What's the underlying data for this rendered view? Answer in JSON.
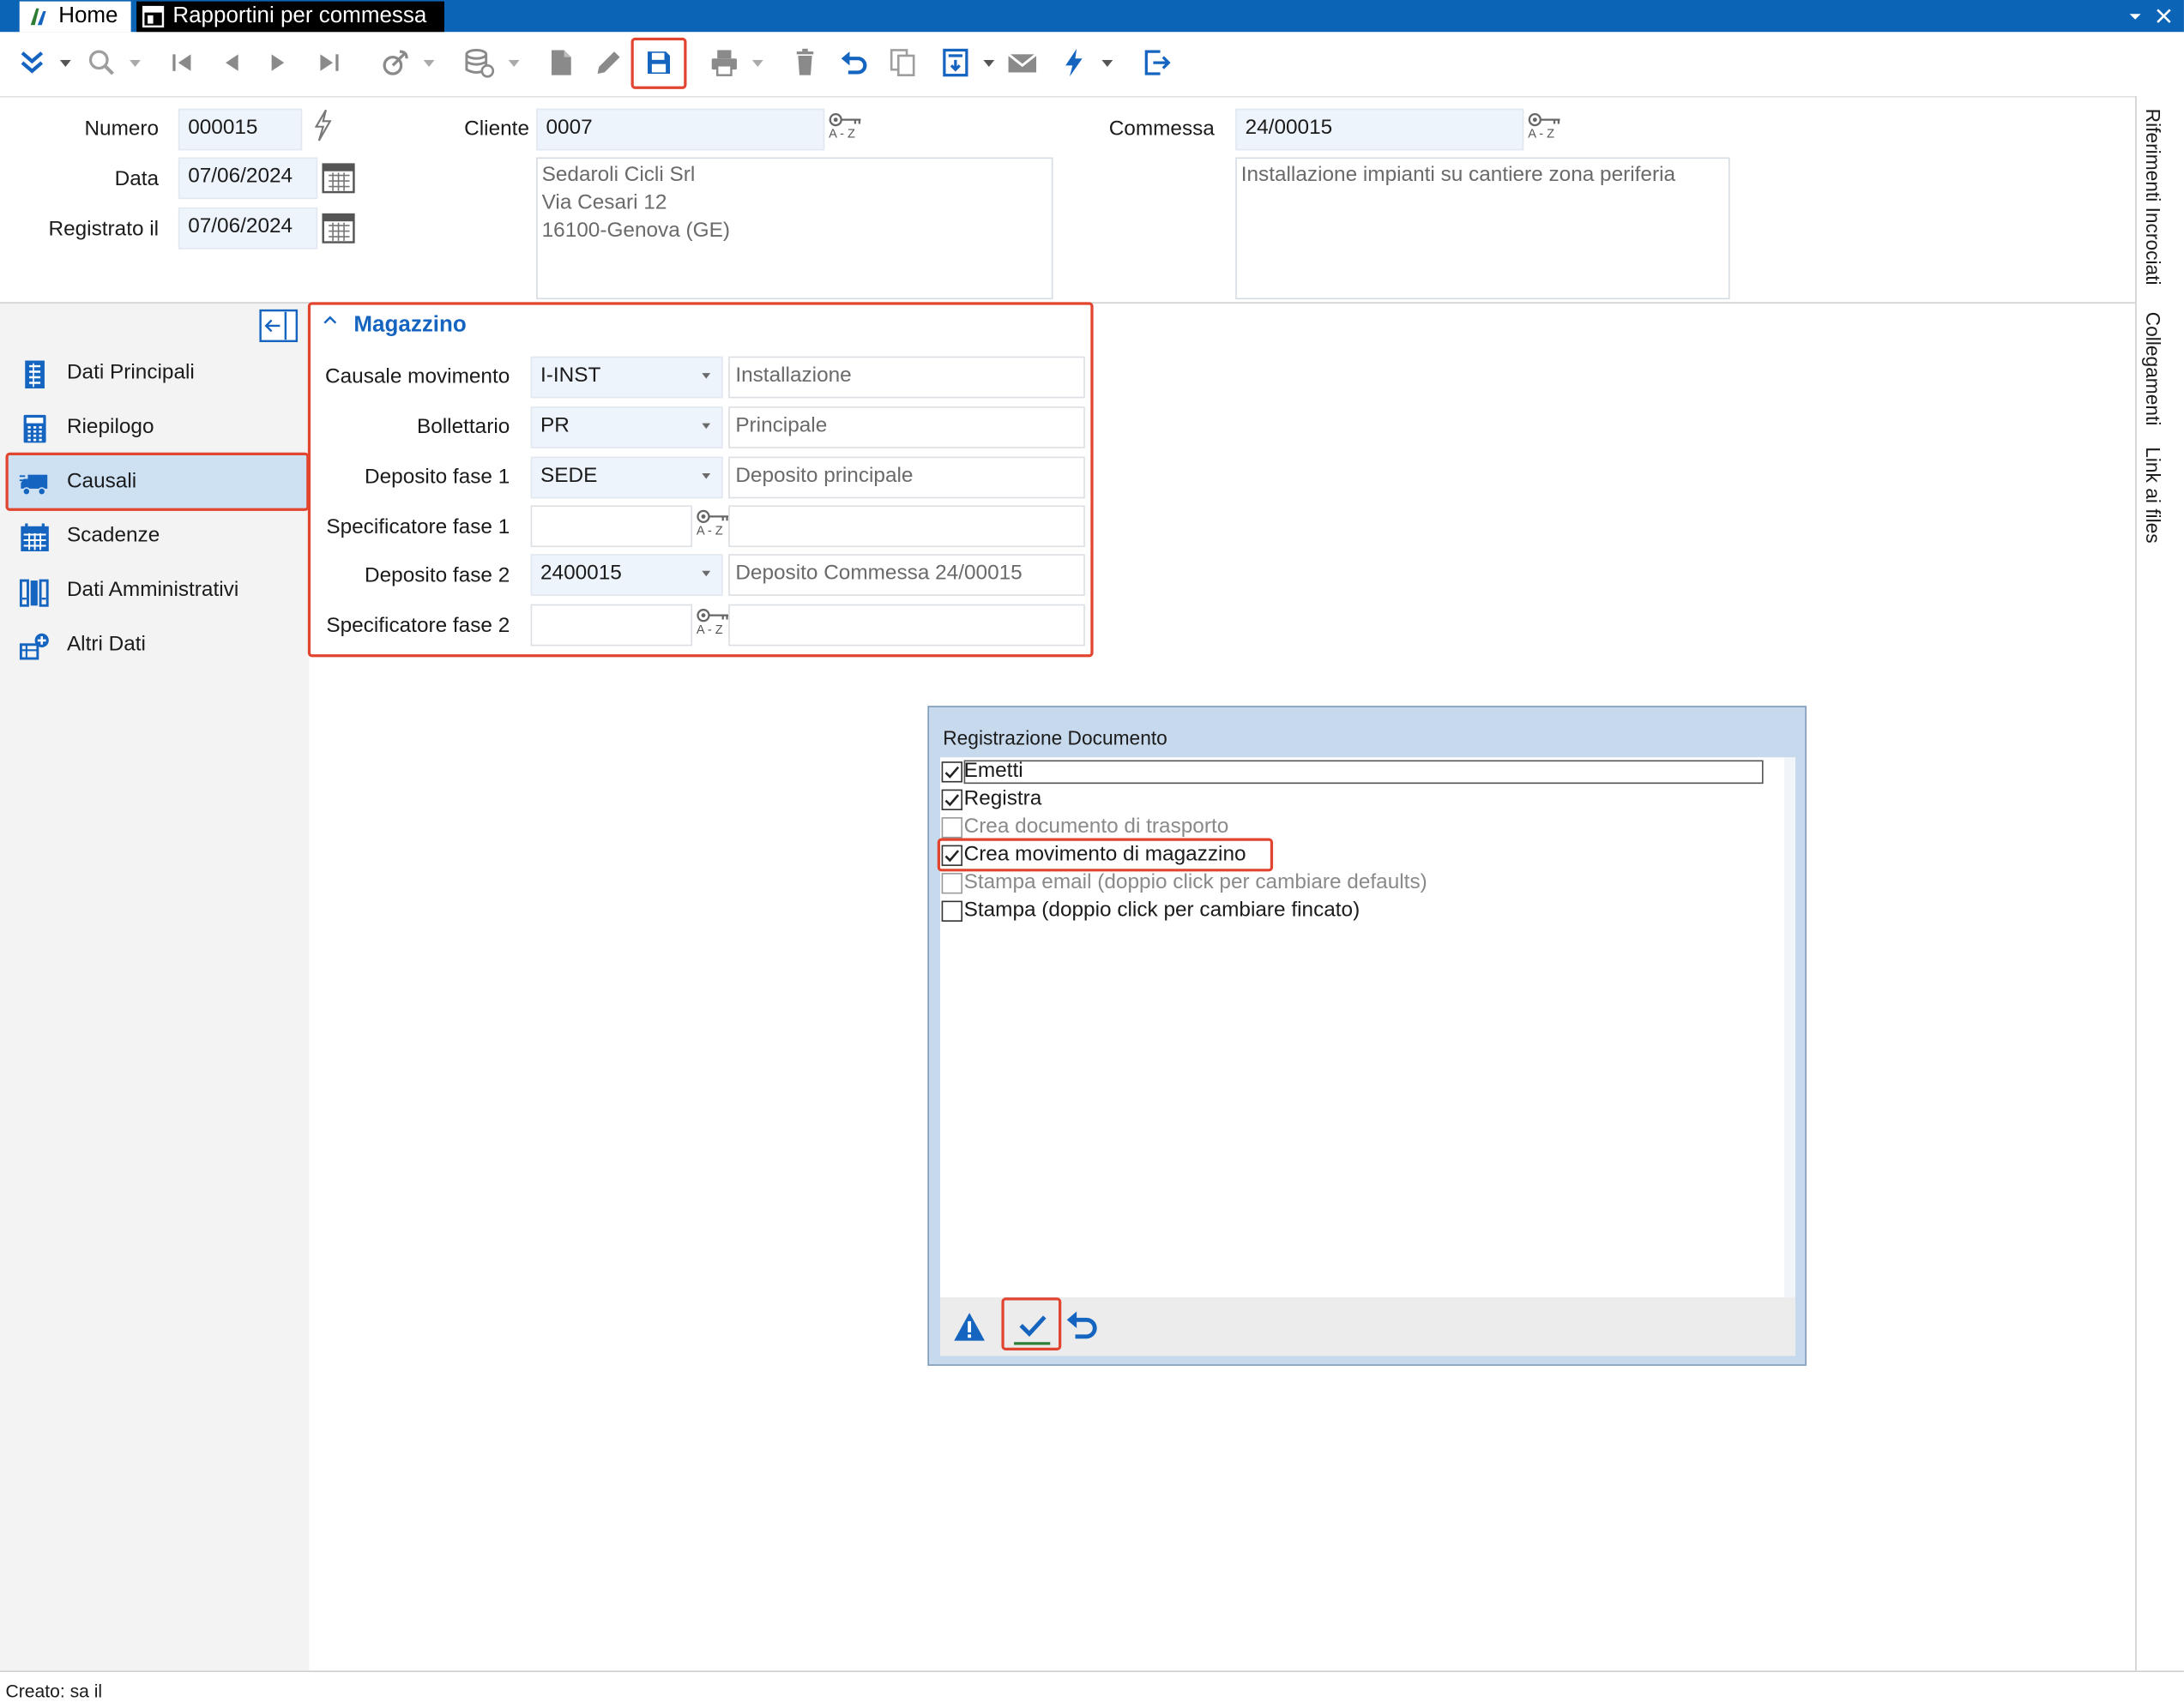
{
  "titlebar": {
    "tabs": [
      {
        "label": "Home"
      },
      {
        "label": "Rapportini per commessa"
      }
    ]
  },
  "toolbar": {
    "icons": [
      "expand-icon",
      "search-icon",
      "first-record-icon",
      "previous-record-icon",
      "next-record-icon",
      "last-record-icon",
      "satellite-icon",
      "database-icon",
      "new-document-icon",
      "edit-icon",
      "save-icon",
      "print-icon",
      "delete-icon",
      "undo-icon",
      "duplicate-icon",
      "import-icon",
      "mail-icon",
      "lightning-icon",
      "exit-icon"
    ]
  },
  "header": {
    "numero_label": "Numero",
    "numero_value": "000015",
    "data_label": "Data",
    "data_value": "07/06/2024",
    "registrato_label": "Registrato il",
    "registrato_value": "07/06/2024",
    "cliente_label": "Cliente",
    "cliente_code": "0007",
    "cliente_lines": [
      "Sedaroli Cicli Srl",
      "Via Cesari 12",
      "16100-Genova (GE)"
    ],
    "commessa_label": "Commessa",
    "commessa_code": "24/00015",
    "commessa_desc": "Installazione impianti su cantiere zona periferia",
    "az_label": "A - Z"
  },
  "nav": {
    "items": [
      {
        "label": "Dati Principali",
        "icon": "document-list-icon",
        "selected": false
      },
      {
        "label": "Riepilogo",
        "icon": "calculator-icon",
        "selected": false
      },
      {
        "label": "Causali",
        "icon": "truck-icon",
        "selected": true
      },
      {
        "label": "Scadenze",
        "icon": "calendar-icon",
        "selected": false
      },
      {
        "label": "Dati Amministrativi",
        "icon": "binders-icon",
        "selected": false
      },
      {
        "label": "Altri Dati",
        "icon": "add-data-icon",
        "selected": false
      }
    ]
  },
  "magazzino": {
    "title": "Magazzino",
    "rows": [
      {
        "label": "Causale movimento",
        "value": "I-INST",
        "desc": "Installazione",
        "kind": "dropdown"
      },
      {
        "label": "Bollettario",
        "value": "PR",
        "desc": "Principale",
        "kind": "dropdown"
      },
      {
        "label": "Deposito fase 1",
        "value": "SEDE",
        "desc": "Deposito principale",
        "kind": "dropdown"
      },
      {
        "label": "Specificatore fase 1",
        "value": "",
        "desc": "",
        "kind": "lookup"
      },
      {
        "label": "Deposito fase 2",
        "value": "2400015",
        "desc": "Deposito Commessa 24/00015",
        "kind": "dropdown"
      },
      {
        "label": "Specificatore fase 2",
        "value": "",
        "desc": "",
        "kind": "lookup"
      }
    ]
  },
  "rightbar": {
    "tabs": [
      "Riferimenti Incrociati",
      "Collegamenti",
      "Link ai files"
    ]
  },
  "dialog": {
    "title": "Registrazione Documento",
    "options": [
      {
        "label": "Emetti",
        "checked": true,
        "enabled": true
      },
      {
        "label": "Registra",
        "checked": true,
        "enabled": true
      },
      {
        "label": "Crea documento di trasporto",
        "checked": false,
        "enabled": false
      },
      {
        "label": "Crea movimento di magazzino",
        "checked": true,
        "enabled": true
      },
      {
        "label": "Stampa email (doppio click per cambiare defaults)",
        "checked": false,
        "enabled": false
      },
      {
        "label": "Stampa (doppio click per cambiare fincato)",
        "checked": false,
        "enabled": true
      }
    ]
  },
  "status": {
    "text": "Creato: sa il"
  },
  "colors": {
    "titlebar": "#0b64b5",
    "accent": "#1565c0",
    "highlight": "#e2452f",
    "selected_nav": "#cde1f3"
  }
}
